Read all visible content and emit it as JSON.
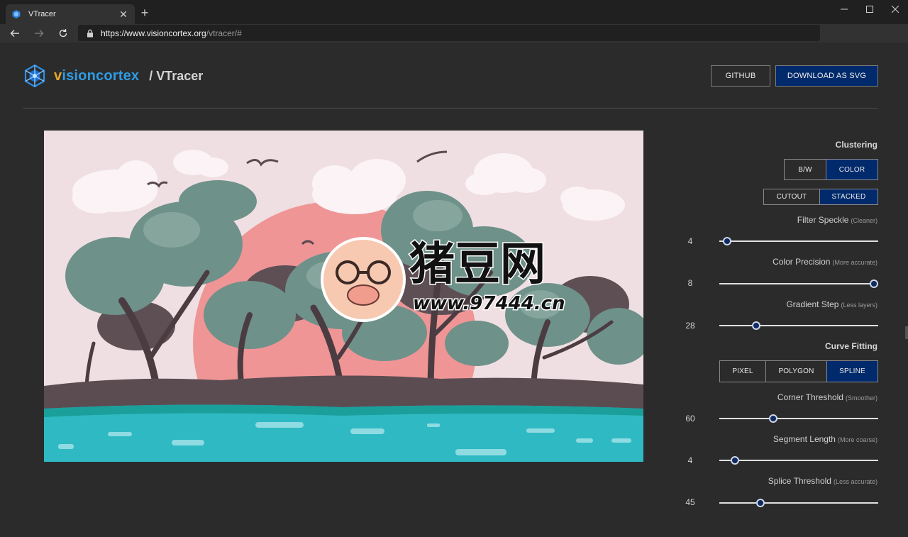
{
  "browser": {
    "tab_title": "VTracer",
    "tab_close": "✕",
    "new_tab": "+",
    "url_host": "https://www.visioncortex.org",
    "url_path": "/vtracer/#",
    "window_controls": [
      "minimize-icon",
      "maximize-icon",
      "close-icon"
    ]
  },
  "header": {
    "brand_part1": "v",
    "brand_part2": "ision",
    "brand_part3": "cortex",
    "product": "/ VTracer",
    "github_label": "GITHUB",
    "download_label": "DOWNLOAD AS SVG"
  },
  "canvas": {
    "watermark_cn": "猪豆网",
    "watermark_url": "www.97444.cn"
  },
  "controls": {
    "clustering_title": "Clustering",
    "color_mode": {
      "options": [
        "B/W",
        "COLOR"
      ],
      "selected": "COLOR"
    },
    "hierarchy": {
      "options": [
        "CUTOUT",
        "STACKED"
      ],
      "selected": "STACKED"
    },
    "filter_speckle": {
      "label": "Filter Speckle",
      "hint": "(Cleaner)",
      "value": "4",
      "position": 0.05
    },
    "color_precision": {
      "label": "Color Precision",
      "hint": "(More accurate)",
      "value": "8",
      "position": 1.0
    },
    "gradient_step": {
      "label": "Gradient Step",
      "hint": "(Less layers)",
      "value": "28",
      "position": 0.23
    },
    "curve_fitting_title": "Curve Fitting",
    "curve_mode": {
      "options": [
        "PIXEL",
        "POLYGON",
        "SPLINE"
      ],
      "selected": "SPLINE"
    },
    "corner_threshold": {
      "label": "Corner Threshold",
      "hint": "(Smoother)",
      "value": "60",
      "position": 0.34
    },
    "segment_length": {
      "label": "Segment Length",
      "hint": "(More coarse)",
      "value": "4",
      "position": 0.1
    },
    "splice_threshold": {
      "label": "Splice Threshold",
      "hint": "(Less accurate)",
      "value": "45",
      "position": 0.26
    }
  },
  "colors": {
    "accent": "#002a6b",
    "brand_orange": "#e6a52d",
    "brand_blue": "#2f9be3"
  }
}
